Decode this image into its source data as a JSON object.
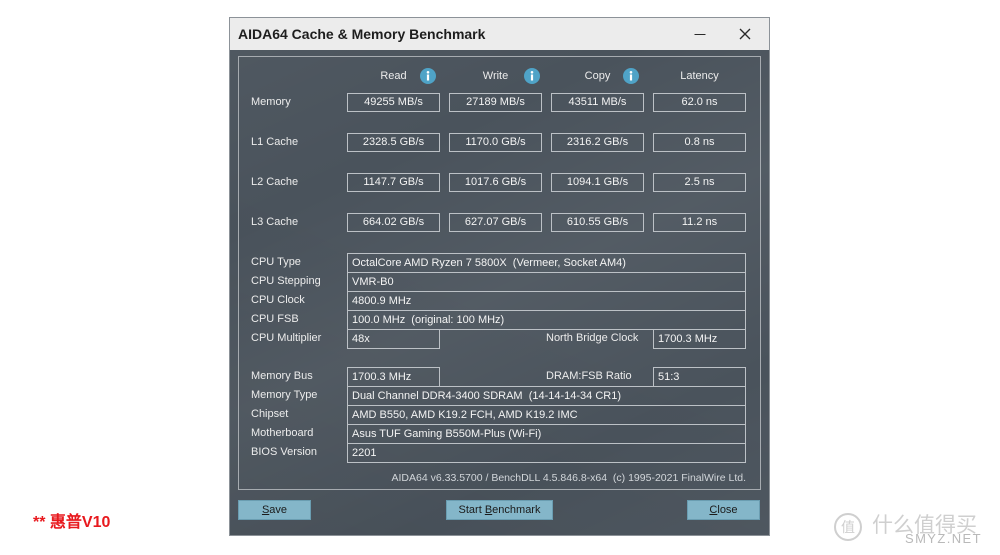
{
  "window": {
    "title": "AIDA64 Cache & Memory Benchmark"
  },
  "columns": [
    "Read",
    "Write",
    "Copy",
    "Latency"
  ],
  "benchmark": [
    {
      "label": "Memory",
      "read": "49255 MB/s",
      "write": "27189 MB/s",
      "copy": "43511 MB/s",
      "latency": "62.0 ns"
    },
    {
      "label": "L1 Cache",
      "read": "2328.5 GB/s",
      "write": "1170.0 GB/s",
      "copy": "2316.2 GB/s",
      "latency": "0.8 ns"
    },
    {
      "label": "L2 Cache",
      "read": "1147.7 GB/s",
      "write": "1017.6 GB/s",
      "copy": "1094.1 GB/s",
      "latency": "2.5 ns"
    },
    {
      "label": "L3 Cache",
      "read": "664.02 GB/s",
      "write": "627.07 GB/s",
      "copy": "610.55 GB/s",
      "latency": "11.2 ns"
    }
  ],
  "cpu": {
    "type": {
      "label": "CPU Type",
      "value": "OctalCore AMD Ryzen 7 5800X  (Vermeer, Socket AM4)"
    },
    "stepping": {
      "label": "CPU Stepping",
      "value": "VMR-B0"
    },
    "clock": {
      "label": "CPU Clock",
      "value": "4800.9 MHz"
    },
    "fsb": {
      "label": "CPU FSB",
      "value": "100.0 MHz  (original: 100 MHz)"
    },
    "multiplier": {
      "label": "CPU Multiplier",
      "value": "48x"
    },
    "nb_clock": {
      "label": "North Bridge Clock",
      "value": "1700.3 MHz"
    }
  },
  "memory": {
    "bus": {
      "label": "Memory Bus",
      "value": "1700.3 MHz"
    },
    "dram_fsb": {
      "label": "DRAM:FSB Ratio",
      "value": "51:3"
    },
    "type": {
      "label": "Memory Type",
      "value": "Dual Channel DDR4-3400 SDRAM  (14-14-14-34 CR1)"
    }
  },
  "board": {
    "chipset": {
      "label": "Chipset",
      "value": "AMD B550, AMD K19.2 FCH, AMD K19.2 IMC"
    },
    "motherboard": {
      "label": "Motherboard",
      "value": "Asus TUF Gaming B550M-Plus (Wi-Fi)"
    },
    "bios": {
      "label": "BIOS Version",
      "value": "2201"
    }
  },
  "footer": "AIDA64 v6.33.5700 / BenchDLL 4.5.846.8-x64  (c) 1995-2021 FinalWire Ltd.",
  "buttons": {
    "save": "Save",
    "start": "Start Benchmark",
    "close": "Close"
  },
  "annotation": "** 惠普V10",
  "watermark": {
    "logo_char": "值",
    "brand": "什么值得买",
    "site": "SMYZ.NET"
  },
  "icons": {
    "info": "info-icon",
    "minimize": "minimize-icon",
    "close": "close-icon"
  },
  "colors": {
    "window_body": "#4a535c",
    "title_bar": "#ececec",
    "button": "#84b6c9",
    "info_icon": "#4fa3c7",
    "annotation": "#e8191e",
    "watermark": "#cfcfcf"
  }
}
